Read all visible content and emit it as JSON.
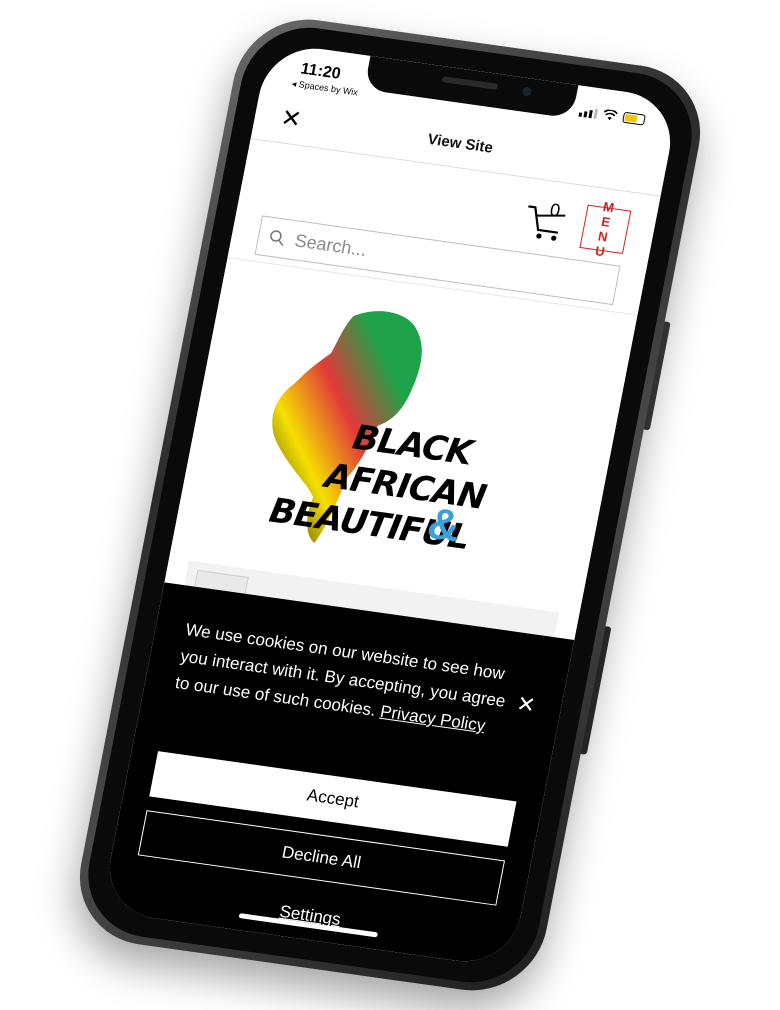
{
  "status_bar": {
    "time": "11:20",
    "back_app": "◂ Spaces by Wix"
  },
  "topnav": {
    "close_icon": "close-icon",
    "title": "View Site"
  },
  "header": {
    "cart_count": "0",
    "menu_label": "MENU",
    "search_placeholder": "Search..."
  },
  "logo": {
    "line1": "BLACK",
    "line2": "AFRICAN",
    "line3": "BEAUTIFUL",
    "ampersand": "&"
  },
  "cookie": {
    "message": "We use cookies on our website to see how you interact with it. By accepting, you agree to our use of such cookies.",
    "policy_link": "Privacy Policy",
    "accept_label": "Accept",
    "decline_label": "Decline All",
    "settings_label": "Settings"
  },
  "colors": {
    "accent_red": "#d32020",
    "ampersand_blue": "#3aa0d8",
    "banner_bg": "#000000"
  }
}
